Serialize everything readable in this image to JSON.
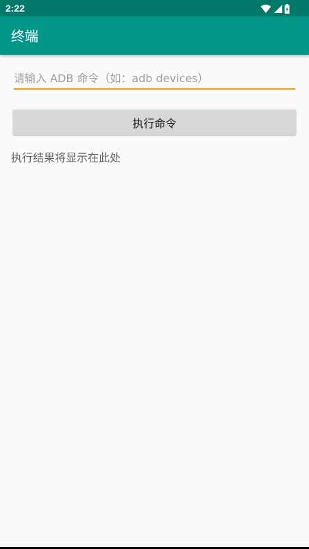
{
  "status_bar": {
    "time": "2:22",
    "icons": [
      "wifi-icon",
      "cell-signal-icon",
      "battery-icon"
    ]
  },
  "app_bar": {
    "title": "终端"
  },
  "command_input": {
    "value": "",
    "placeholder": "请输入 ADB 命令（如：adb devices）"
  },
  "execute_button": {
    "label": "执行命令"
  },
  "result": {
    "text": "执行结果将显示在此处"
  },
  "colors": {
    "status_bar": "#00796b",
    "app_bar": "#009688",
    "input_underline": "#ff9800",
    "button_bg": "#d6d7d7",
    "background": "#fafafa"
  }
}
